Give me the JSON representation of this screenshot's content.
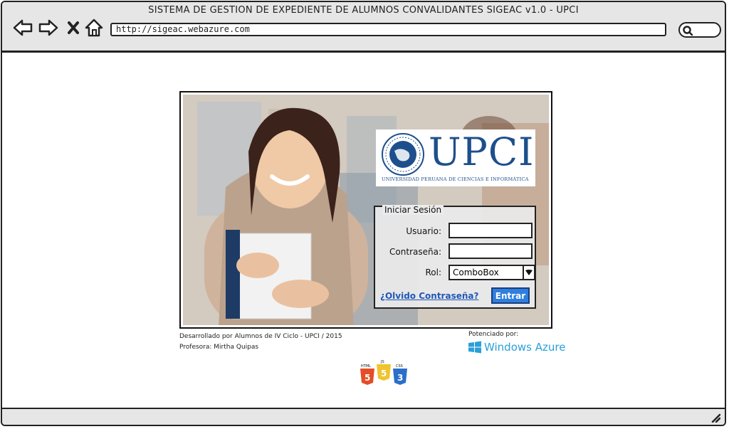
{
  "window": {
    "title": "SISTEMA DE GESTION DE EXPEDIENTE DE ALUMNOS CONVALIDANTES SIGEAC v1.0 - UPCI"
  },
  "browser": {
    "url": "http://sigeac.webazure.com",
    "icons": [
      "back-arrow-icon",
      "forward-arrow-icon",
      "close-x-icon",
      "home-icon",
      "search-icon"
    ]
  },
  "logo": {
    "text": "UPCI",
    "subtitle": "UNIVERSIDAD PERUANA DE CIENCIAS E INFORMÁTICA"
  },
  "login": {
    "legend": "Iniciar Sesión",
    "user_label": "Usuario:",
    "user_value": "",
    "password_label": "Contraseña:",
    "password_value": "",
    "role_label": "Rol:",
    "role_value": "ComboBox",
    "forgot_link": "¿Olvido Contraseña?",
    "submit_label": "Entrar"
  },
  "footer": {
    "developed_by": "Desarrollado por Alumnos de IV Ciclo - UPCI / 2015",
    "professor": "Profesora: Mirtha Quipas",
    "powered_by": "Potenciado por:",
    "platform": "Windows Azure"
  },
  "badges": [
    "HTML",
    "JS",
    "CSS"
  ],
  "colors": {
    "accent": "#2f7fde",
    "link": "#1f58b8",
    "brand": "#1d4f8c",
    "azure": "#2a9fd8"
  }
}
